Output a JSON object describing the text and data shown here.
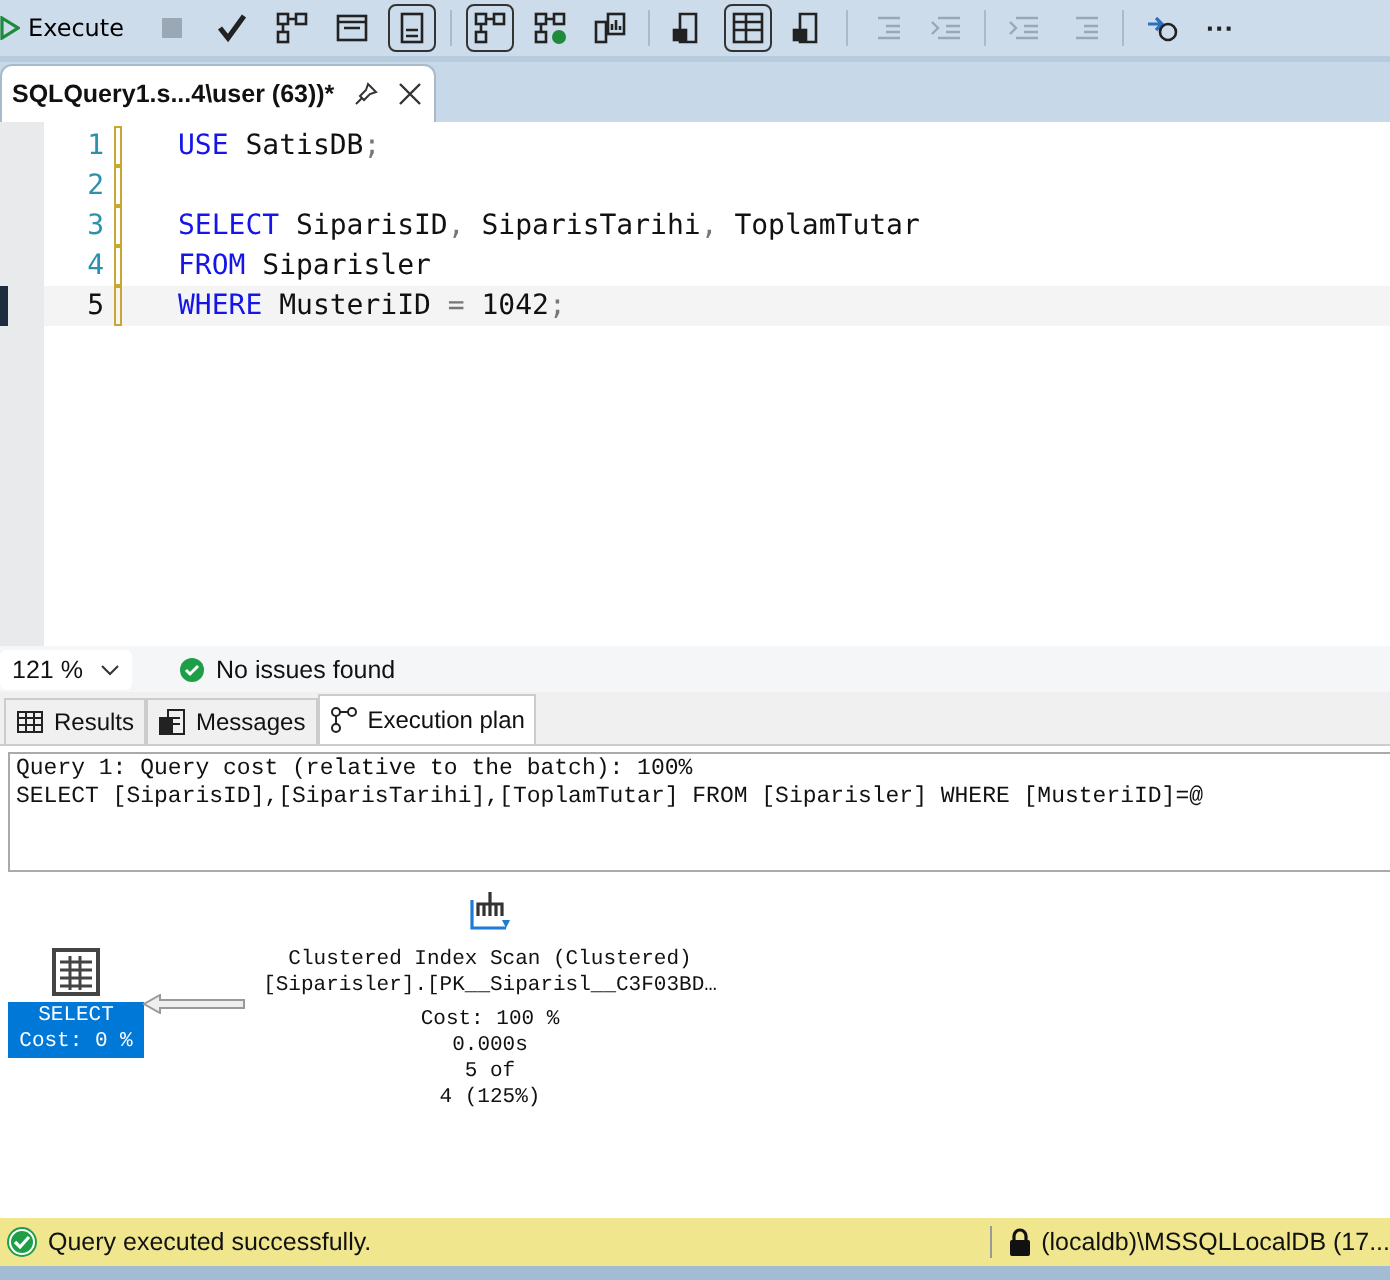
{
  "toolbar": {
    "execute": {
      "label": "Execute"
    },
    "buttons": [
      {
        "kind": "stop",
        "disabled": true
      },
      {
        "kind": "check",
        "disabled": false
      },
      {
        "kind": "tree",
        "disabled": false
      },
      {
        "kind": "window",
        "disabled": false
      },
      {
        "kind": "form",
        "on": true,
        "disabled": false
      },
      {
        "kind": "sep"
      },
      {
        "kind": "plan",
        "on": true,
        "disabled": false
      },
      {
        "kind": "planok",
        "disabled": false
      },
      {
        "kind": "stats",
        "disabled": false
      },
      {
        "kind": "sep"
      },
      {
        "kind": "text",
        "disabled": false
      },
      {
        "kind": "grid",
        "on": true,
        "disabled": false
      },
      {
        "kind": "file",
        "disabled": false
      },
      {
        "kind": "sep"
      },
      {
        "kind": "comment",
        "disabled": true
      },
      {
        "kind": "uncomment",
        "disabled": true
      },
      {
        "kind": "sep"
      },
      {
        "kind": "outdent",
        "disabled": true
      },
      {
        "kind": "indent",
        "disabled": true
      },
      {
        "kind": "sep"
      },
      {
        "kind": "param",
        "disabled": false
      }
    ],
    "more": "···"
  },
  "document_tab": {
    "title": "SQLQuery1.s...4\\user (63))*",
    "selected": true
  },
  "editor": {
    "lines": [
      {
        "number": "1",
        "current": false,
        "tokens": [
          {
            "kind": "keyword",
            "text": "USE"
          },
          {
            "kind": "text",
            "text": " SatisDB"
          },
          {
            "kind": "punct",
            "text": ";"
          }
        ]
      },
      {
        "number": "2",
        "current": false
      },
      {
        "number": "3",
        "current": false,
        "tokens": [
          {
            "kind": "keyword",
            "text": "SELECT"
          },
          {
            "kind": "text",
            "text": " SiparisID"
          },
          {
            "kind": "punct",
            "text": ","
          },
          {
            "kind": "text",
            "text": " SiparisTarihi"
          },
          {
            "kind": "punct",
            "text": ","
          },
          {
            "kind": "text",
            "text": " ToplamTutar"
          }
        ]
      },
      {
        "number": "4",
        "current": false,
        "tokens": [
          {
            "kind": "keyword",
            "text": "FROM"
          },
          {
            "kind": "text",
            "text": " Siparisler"
          }
        ]
      },
      {
        "number": "5",
        "current": true,
        "tokens": [
          {
            "kind": "keyword",
            "text": "WHERE"
          },
          {
            "kind": "text",
            "text": " MusteriID "
          },
          {
            "kind": "punct",
            "text": "="
          },
          {
            "kind": "text",
            "text": " 1042"
          },
          {
            "kind": "punct",
            "text": ";"
          }
        ]
      }
    ]
  },
  "editor_status": {
    "zoom": "121 %",
    "issues": "No issues found"
  },
  "result_tabs": [
    {
      "label": "Results",
      "kind": "grid",
      "selected": false
    },
    {
      "label": "Messages",
      "kind": "messages",
      "selected": false
    },
    {
      "label": "Execution plan",
      "kind": "plan",
      "selected": true
    }
  ],
  "plan": {
    "header": [
      "Query 1: Query cost (relative to the batch): 100%",
      "SELECT [SiparisID],[SiparisTarihi],[ToplamTutar] FROM [Siparisler] WHERE [MusteriID]=@"
    ],
    "select_node": {
      "label": "SELECT",
      "cost": "Cost: 0 %",
      "selected": true
    },
    "scan_node": {
      "lines": [
        "Clustered Index Scan (Clustered)",
        "[Siparisler].[PK__Siparisl__C3F03BD…",
        "Cost: 100 %",
        "0.000s",
        "5 of",
        "4 (125%)"
      ]
    }
  },
  "status_bar": {
    "message": "Query executed successfully.",
    "server": "(localdb)\\MSSQLLocalDB (17..."
  }
}
